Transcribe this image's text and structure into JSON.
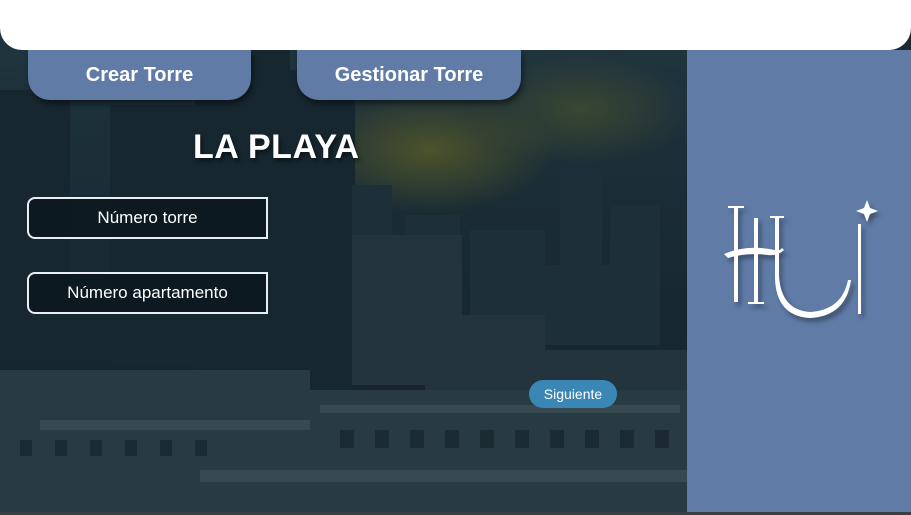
{
  "tabs": [
    {
      "label": "Crear Torre"
    },
    {
      "label": "Gestionar Torre"
    }
  ],
  "title": "LA PLAYA",
  "fields": {
    "torre": {
      "placeholder": "Número torre",
      "value": ""
    },
    "apartamento": {
      "placeholder": "Número apartamento",
      "value": ""
    }
  },
  "next_button": {
    "label": "Siguiente"
  },
  "logo": {
    "icon": "hu-monogram-logo",
    "text": "HU"
  },
  "colors": {
    "accent": "#5f7ba6",
    "button": "#3a86b4",
    "top_bar": "#ffffff"
  }
}
